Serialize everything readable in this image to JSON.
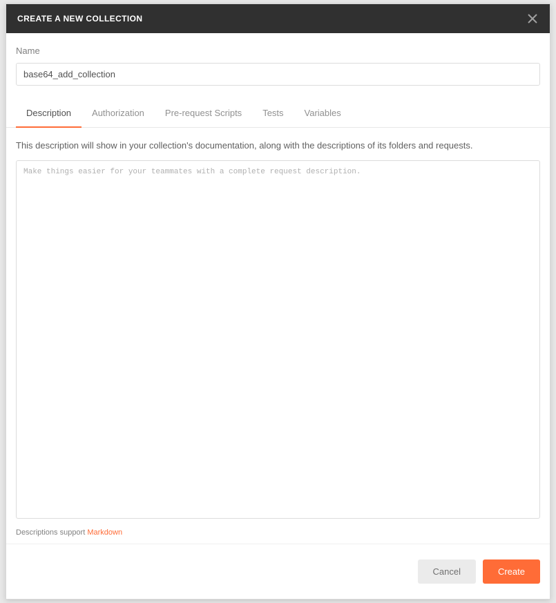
{
  "modal": {
    "title": "CREATE A NEW COLLECTION"
  },
  "name": {
    "label": "Name",
    "value": "base64_add_collection"
  },
  "tabs": {
    "description": "Description",
    "authorization": "Authorization",
    "prerequest": "Pre-request Scripts",
    "tests": "Tests",
    "variables": "Variables"
  },
  "description": {
    "info": "This description will show in your collection's documentation, along with the descriptions of its folders and requests.",
    "placeholder": "Make things easier for your teammates with a complete request description.",
    "value": "",
    "note_prefix": "Descriptions support ",
    "note_link": "Markdown"
  },
  "footer": {
    "cancel": "Cancel",
    "create": "Create"
  }
}
